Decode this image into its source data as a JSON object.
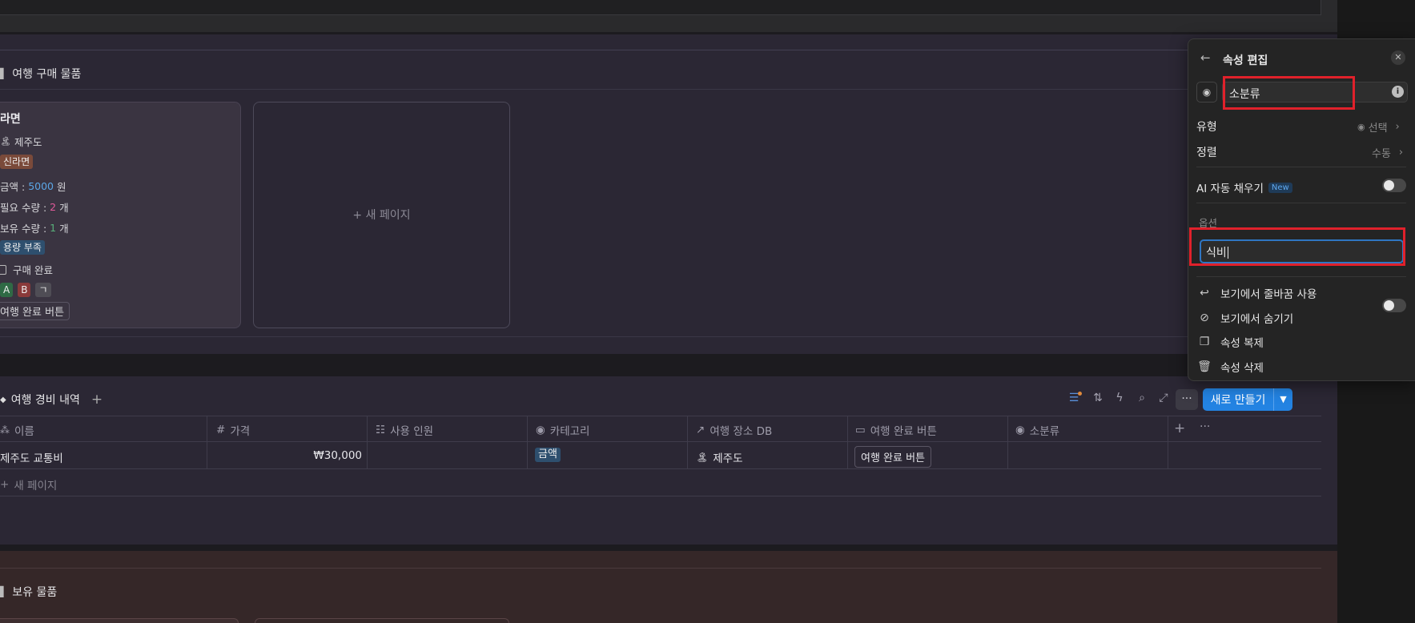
{
  "gallery": {
    "title": "여행 구매 물품",
    "card": {
      "title": "라면",
      "place": "제주도",
      "place_icon": "🏝",
      "tag_category": "신라면",
      "amount_label": "금액 :",
      "amount_value": "5000",
      "amount_unit": "원",
      "need_label": "필요 수량 :",
      "need_value": "2",
      "need_unit": "개",
      "have_label": "보유 수량 :",
      "have_value": "1",
      "have_unit": "개",
      "tag_status": "용량 부족",
      "checkbox_label": "구매 완료",
      "tags": [
        "A",
        "B",
        "ㄱ"
      ],
      "button_label": "여행 완료 버튼"
    },
    "new_page": "새 페이지"
  },
  "table": {
    "title": "여행 경비 내역",
    "new_button": "새로 만들기",
    "columns": [
      "이름",
      "가격",
      "사용 인원",
      "카테고리",
      "여행 장소 DB",
      "여행 완료 버튼",
      "소분류"
    ],
    "rows": [
      {
        "name": "제주도 교통비",
        "price": "₩30,000",
        "people": "",
        "category": "금액",
        "place": "제주도",
        "place_icon": "🏝",
        "button": "여행 완료 버튼",
        "sub": ""
      }
    ],
    "new_page": "새 페이지"
  },
  "third_section": {
    "title": "보유 물품"
  },
  "panel": {
    "title": "속성 편집",
    "name_value": "소분류",
    "type_label": "유형",
    "type_value": "선택",
    "sort_label": "정렬",
    "sort_value": "수동",
    "ai_label": "AI 자동 채우기",
    "ai_badge": "New",
    "options_label": "옵션",
    "option_input_value": "식비",
    "wrap_label": "보기에서 줄바꿈 사용",
    "hide_label": "보기에서 숨기기",
    "duplicate_label": "속성 복제",
    "delete_label": "속성 삭제"
  },
  "colors": {
    "accent": "#2383e2",
    "highlight": "#e0212b",
    "tag_brown": "#7a4a3a",
    "tag_blue": "#2e4f6e",
    "tag_green": "#2f6a45",
    "tag_red": "#8a3a3a",
    "tag_gray": "#4f4d55"
  }
}
